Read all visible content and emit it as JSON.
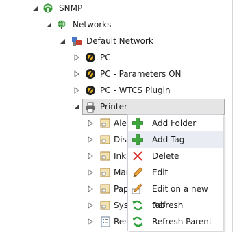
{
  "tree": {
    "snmp": {
      "label": "SNMP"
    },
    "networks": {
      "label": "Networks"
    },
    "default_network": {
      "label": "Default Network"
    },
    "pc": {
      "label": "PC"
    },
    "pc_params": {
      "label": "PC - Parameters ON"
    },
    "pc_wtcs": {
      "label": "PC - WTCS Plugin"
    },
    "printer": {
      "label": "Printer"
    },
    "printer_children": [
      {
        "label": "Alerts"
      },
      {
        "label": "Display"
      },
      {
        "label": "InkSupply"
      },
      {
        "label": "Marker"
      },
      {
        "label": "Paper"
      },
      {
        "label": "System"
      },
      {
        "label": "Resources"
      }
    ]
  },
  "context_menu": {
    "items": [
      {
        "label": "Add Folder"
      },
      {
        "label": "Add Tag"
      },
      {
        "label": "Delete"
      },
      {
        "label": "Edit"
      },
      {
        "label": "Edit on a new tab"
      },
      {
        "label": "Refresh"
      },
      {
        "label": "Refresh Parent"
      }
    ]
  },
  "colors": {
    "selection_bg": "#e5e5e5",
    "menu_highlight": "#e9edf3",
    "add_icon": "#3ea83e",
    "delete_icon": "#d9352c",
    "refresh_icon": "#2d9e3a"
  }
}
